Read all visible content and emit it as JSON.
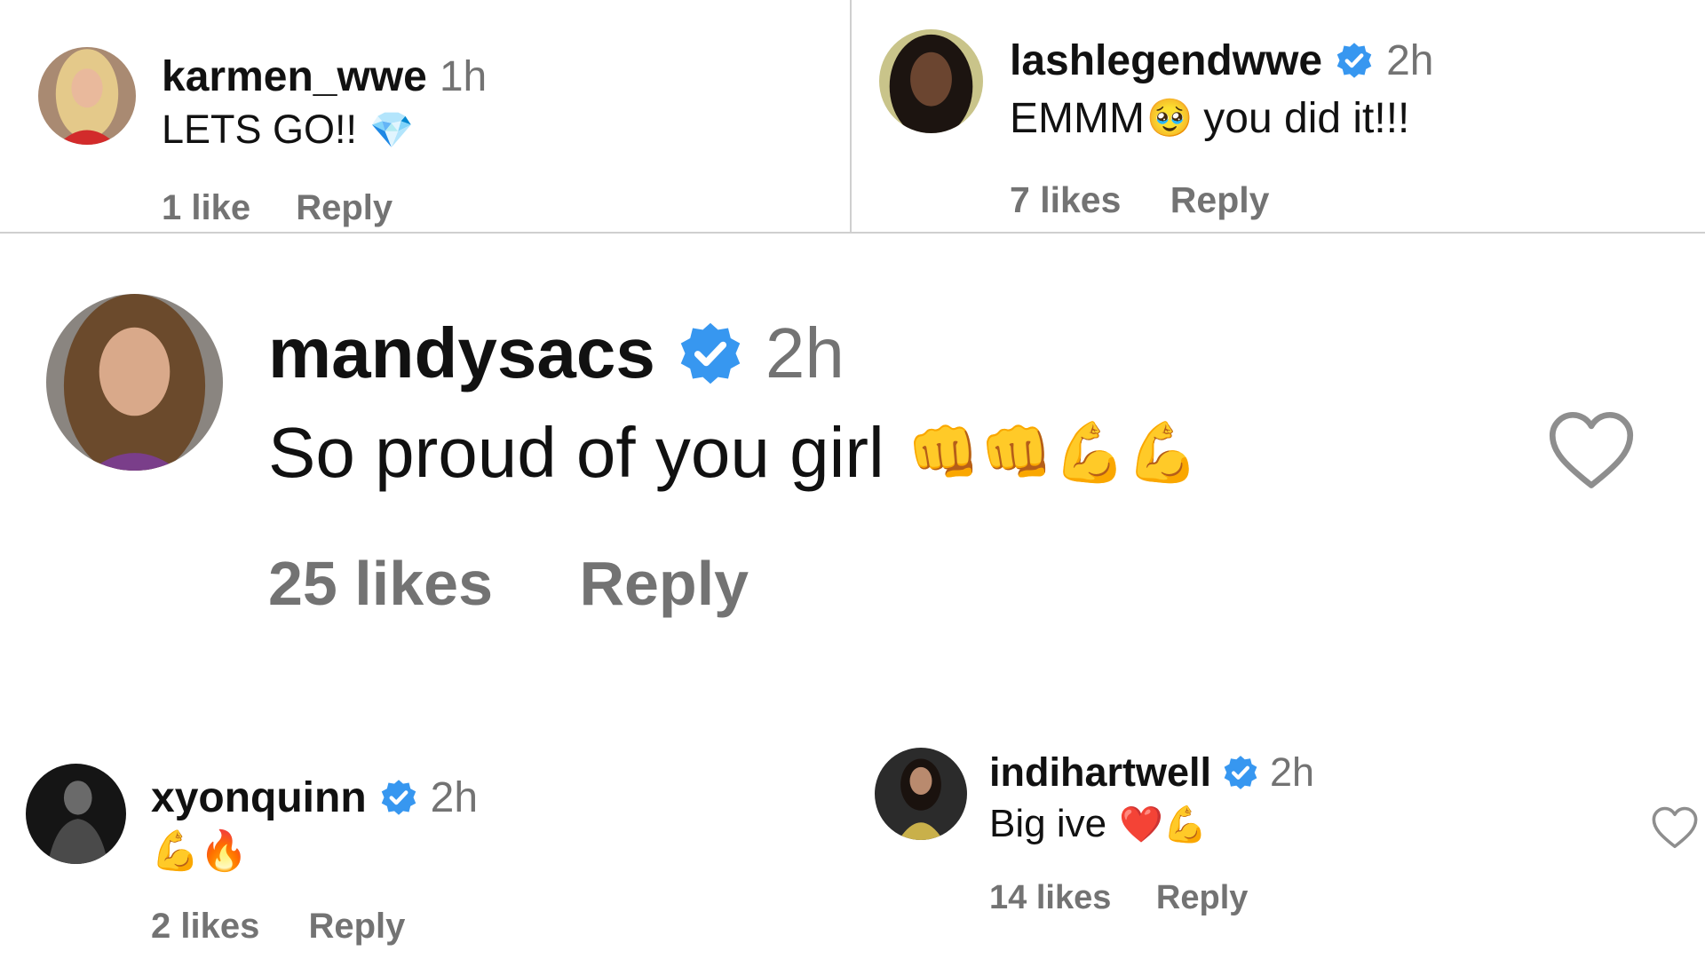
{
  "comments": [
    {
      "id": "karmen",
      "username": "karmen_wwe",
      "verified": false,
      "time": "1h",
      "text": "LETS GO!!",
      "emoji": "💎",
      "likes": "1 like",
      "reply": "Reply"
    },
    {
      "id": "lash",
      "username": "lashlegendwwe",
      "verified": true,
      "time": "2h",
      "text_before": "EMMM",
      "emoji": "🥹",
      "text": "you did it!!!",
      "likes": "7 likes",
      "reply": "Reply"
    },
    {
      "id": "mandy",
      "username": "mandysacs",
      "verified": true,
      "time": "2h",
      "text": "So proud of you girl",
      "emoji": "👊👊💪💪",
      "likes": "25 likes",
      "reply": "Reply"
    },
    {
      "id": "xyon",
      "username": "xyonquinn",
      "verified": true,
      "time": "2h",
      "emoji": "💪🔥",
      "likes": "2 likes",
      "reply": "Reply"
    },
    {
      "id": "indi",
      "username": "indihartwell",
      "verified": true,
      "time": "2h",
      "text": "Big ive",
      "emoji": "❤️💪",
      "likes": "14 likes",
      "reply": "Reply"
    }
  ],
  "colors": {
    "verified_badge": "#3797f0",
    "muted_text": "#737373",
    "primary_text": "#111111",
    "divider": "#cfcfcf"
  },
  "icons": {
    "verified": "verified-badge-icon",
    "like": "heart-outline-icon"
  }
}
